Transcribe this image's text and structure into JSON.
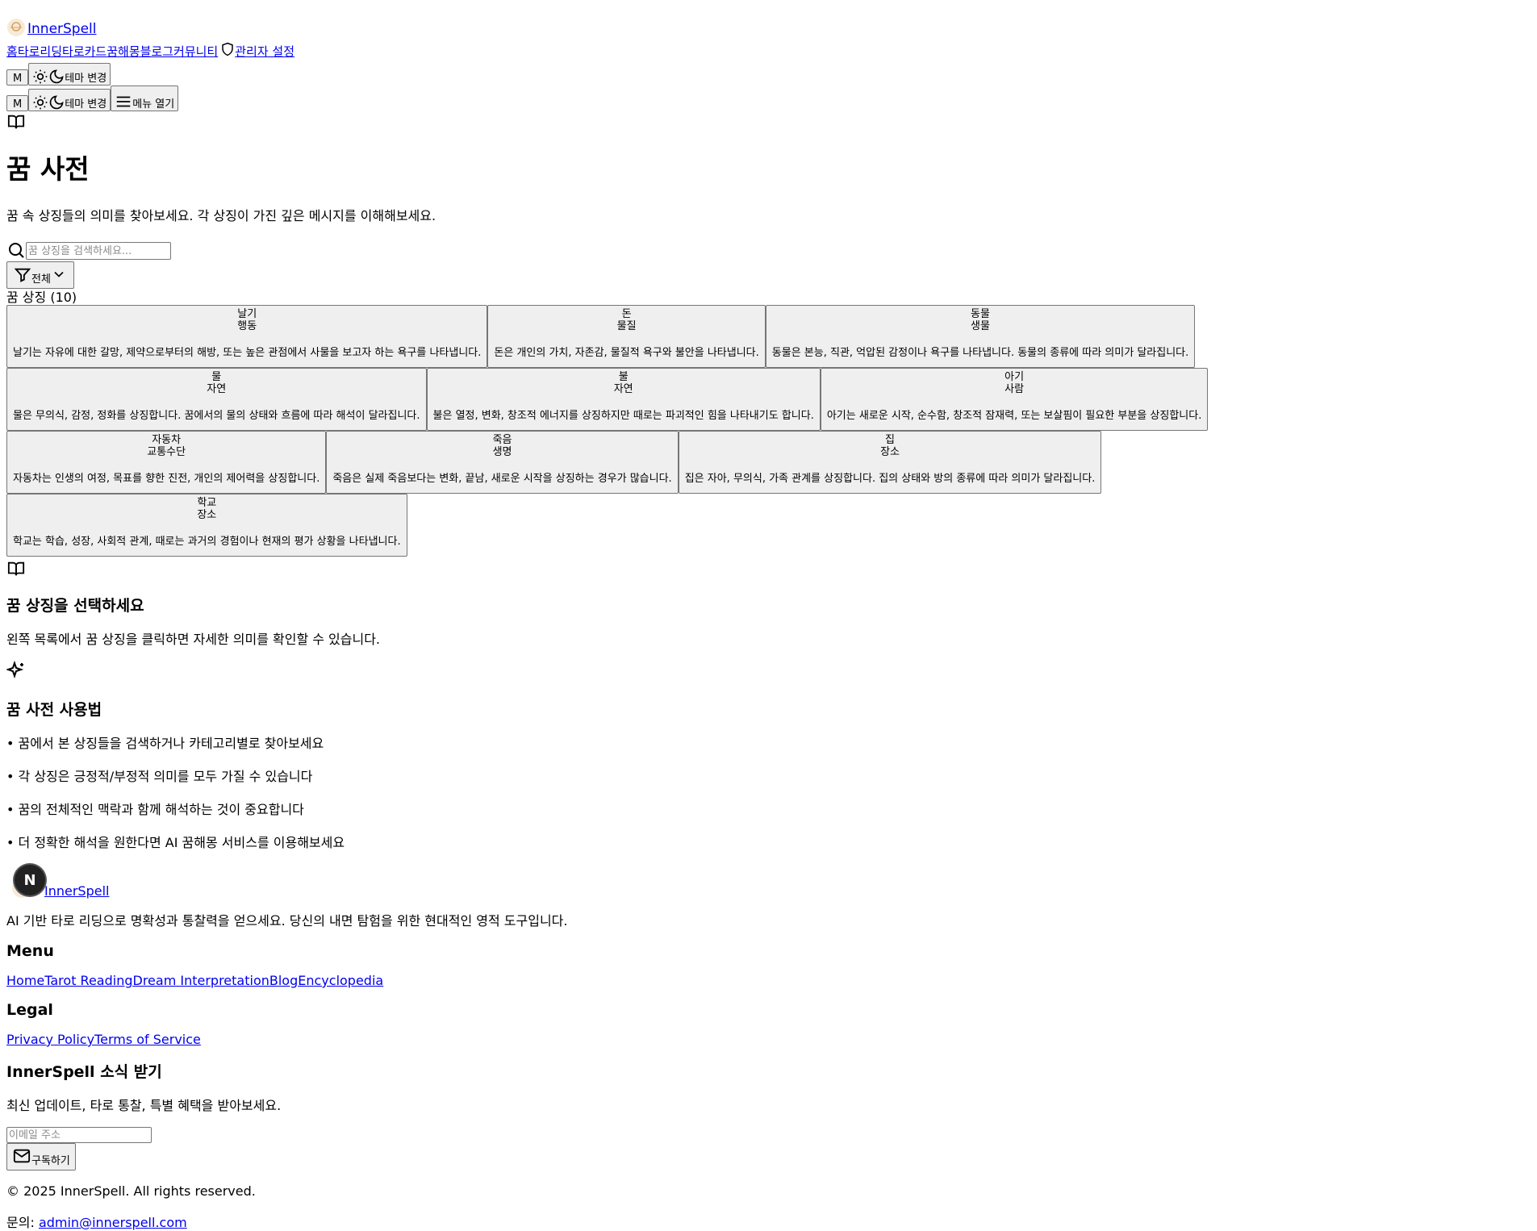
{
  "header": {
    "brand": "InnerSpell",
    "nav": [
      "홈",
      "타로리딩",
      "타로카드",
      "꿈해몽",
      "블로그",
      "커뮤니티"
    ],
    "admin_label": "관리자 설정",
    "avatar_letter": "M",
    "theme_label": "테마 변경",
    "menu_label": "메뉴 열기"
  },
  "main": {
    "title": "꿈 사전",
    "subtitle": "꿈 속 상징들의 의미를 찾아보세요. 각 상징이 가진 깊은 메시지를 이해해보세요.",
    "search_placeholder": "꿈 상징을 검색하세요...",
    "filter_label": "전체",
    "count_label": "꿈 상징 (10)",
    "symbols": [
      {
        "name": "날기",
        "category": "행동",
        "desc": "날기는 자유에 대한 갈망, 제약으로부터의 해방, 또는 높은 관점에서 사물을 보고자 하는 욕구를 나타냅니다."
      },
      {
        "name": "돈",
        "category": "물질",
        "desc": "돈은 개인의 가치, 자존감, 물질적 욕구와 불안을 나타냅니다."
      },
      {
        "name": "동물",
        "category": "생물",
        "desc": "동물은 본능, 직관, 억압된 감정이나 욕구를 나타냅니다. 동물의 종류에 따라 의미가 달라집니다."
      },
      {
        "name": "물",
        "category": "자연",
        "desc": "물은 무의식, 감정, 정화를 상징합니다. 꿈에서의 물의 상태와 흐름에 따라 해석이 달라집니다."
      },
      {
        "name": "불",
        "category": "자연",
        "desc": "불은 열정, 변화, 창조적 에너지를 상징하지만 때로는 파괴적인 힘을 나타내기도 합니다."
      },
      {
        "name": "아기",
        "category": "사람",
        "desc": "아기는 새로운 시작, 순수함, 창조적 잠재력, 또는 보살핌이 필요한 부분을 상징합니다."
      },
      {
        "name": "자동차",
        "category": "교통수단",
        "desc": "자동차는 인생의 여정, 목표를 향한 진전, 개인의 제어력을 상징합니다."
      },
      {
        "name": "죽음",
        "category": "생명",
        "desc": "죽음은 실제 죽음보다는 변화, 끝남, 새로운 시작을 상징하는 경우가 많습니다."
      },
      {
        "name": "집",
        "category": "장소",
        "desc": "집은 자아, 무의식, 가족 관계를 상징합니다. 집의 상태와 방의 종류에 따라 의미가 달라집니다."
      },
      {
        "name": "학교",
        "category": "장소",
        "desc": "학교는 학습, 성장, 사회적 관계, 때로는 과거의 경험이나 현재의 평가 상황을 나타냅니다."
      }
    ],
    "select_title": "꿈 상징을 선택하세요",
    "select_text": "왼쪽 목록에서 꿈 상징을 클릭하면 자세한 의미를 확인할 수 있습니다.",
    "howto_title": "꿈 사전 사용법",
    "howto_items": [
      "• 꿈에서 본 상징들을 검색하거나 카테고리별로 찾아보세요",
      "• 각 상징은 긍정적/부정적 의미를 모두 가질 수 있습니다",
      "• 꿈의 전체적인 맥락과 함께 해석하는 것이 중요합니다",
      "• 더 정확한 해석을 원한다면 AI 꿈해몽 서비스를 이용해보세요"
    ]
  },
  "footer": {
    "brand": "InnerSpell",
    "badge_letter": "N",
    "tagline": "AI 기반 타로 리딩으로 명확성과 통찰력을 얻으세요. 당신의 내면 탐험을 위한 현대적인 영적 도구입니다.",
    "menu_title": "Menu",
    "menu_links": [
      "Home",
      "Tarot Reading",
      "Dream Interpretation",
      "Blog",
      "Encyclopedia"
    ],
    "legal_title": "Legal",
    "legal_links": [
      "Privacy Policy",
      "Terms of Service"
    ],
    "newsletter_title": "InnerSpell 소식 받기",
    "newsletter_text": "최신 업데이트, 타로 통찰, 특별 혜택을 받아보세요.",
    "email_placeholder": "이메일 주소",
    "subscribe_label": "구독하기",
    "copyright": "© 2025 InnerSpell. All rights reserved.",
    "contact_label": "문의:",
    "contact_email": "admin@innerspell.com"
  }
}
